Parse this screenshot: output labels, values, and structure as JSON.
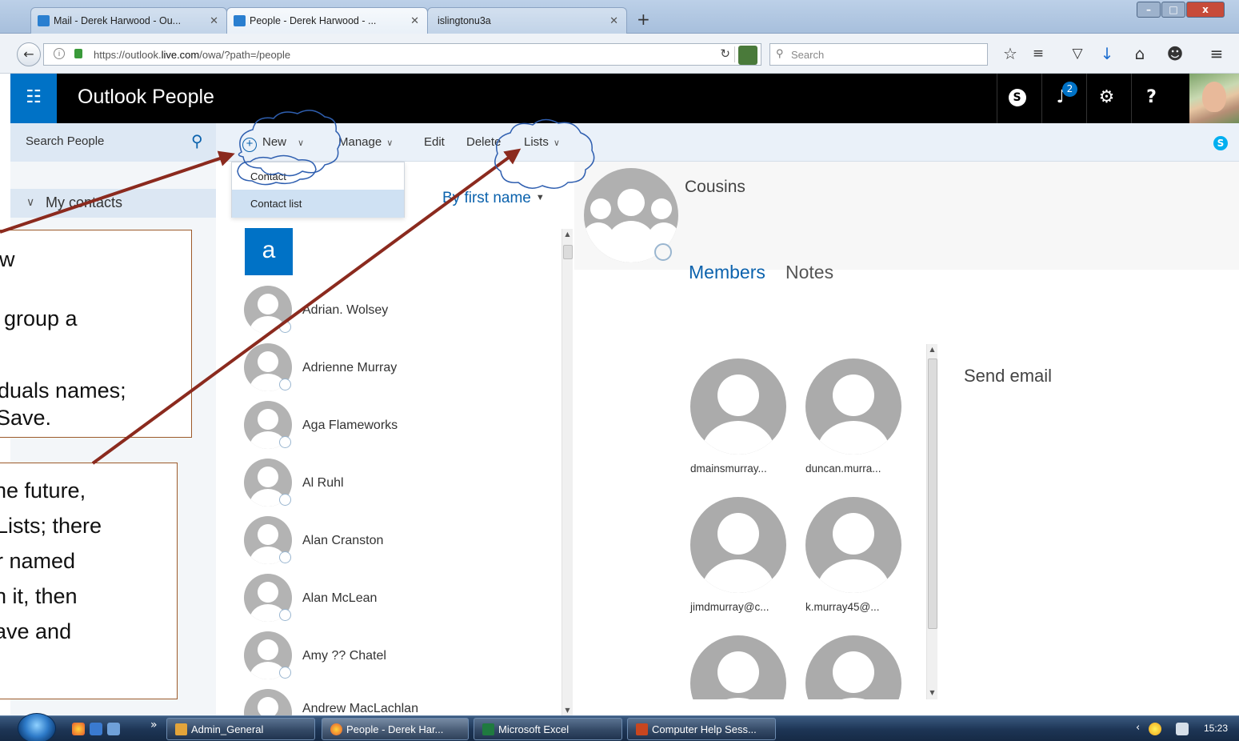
{
  "browser": {
    "tabs": [
      {
        "label": "Mail - Derek Harwood - Ou..."
      },
      {
        "label": "People - Derek Harwood - ..."
      },
      {
        "label": "islingtonu3a"
      }
    ],
    "new_tab": "+",
    "url_prefix": "https://outlook.",
    "url_host": "live.com",
    "url_suffix": "/owa/?path=/people",
    "search_placeholder": "Search",
    "window_controls": {
      "minimize": "–",
      "maximize": "□",
      "close": "x"
    }
  },
  "app": {
    "title": "Outlook People",
    "notifications_count": "2",
    "help_label": "?"
  },
  "commandbar": {
    "search_placeholder": "Search People",
    "new_label": "New",
    "manage_label": "Manage",
    "edit_label": "Edit",
    "delete_label": "Delete",
    "lists_label": "Lists"
  },
  "new_menu": {
    "items": [
      {
        "label": "Contact",
        "selected": false
      },
      {
        "label": "Contact list",
        "selected": true
      }
    ]
  },
  "sidebar": {
    "folder_label": "My contacts"
  },
  "contacts": {
    "sort_label": "By first name",
    "letter_header": "a",
    "items": [
      {
        "name": "Adrian. Wolsey"
      },
      {
        "name": "Adrienne Murray"
      },
      {
        "name": "Aga Flameworks"
      },
      {
        "name": "Al Ruhl"
      },
      {
        "name": "Alan Cranston"
      },
      {
        "name": "Alan McLean"
      },
      {
        "name": "Amy ?? Chatel"
      },
      {
        "name": "Andrew MacLachlan"
      }
    ]
  },
  "detail": {
    "group_name": "Cousins",
    "tabs": [
      {
        "label": "Members",
        "active": true
      },
      {
        "label": "Notes",
        "active": false
      }
    ],
    "members": [
      {
        "name": "dmainsmurray..."
      },
      {
        "name": "duncan.murra..."
      },
      {
        "name": "jimdmurray@c..."
      },
      {
        "name": "k.murray45@..."
      },
      {
        "name": ""
      },
      {
        "name": ""
      }
    ],
    "send_email_label": "Send email"
  },
  "annotations": {
    "callout_1_lines": [
      "w",
      "group a",
      "iduals names;",
      "Save."
    ],
    "callout_2_lines": [
      "he future,",
      "Lists; there",
      "r named",
      "n it, then",
      "ave and"
    ]
  },
  "taskbar": {
    "overflow": "»",
    "tasks": [
      {
        "label": "Admin_General",
        "active": false
      },
      {
        "label": "People - Derek Har...",
        "active": true
      },
      {
        "label": "Microsoft Excel",
        "active": false
      },
      {
        "label": "Computer Help Sess...",
        "active": false
      }
    ],
    "clock": "15:23"
  },
  "colors": {
    "accent": "#0072c6",
    "header_bg": "#000000",
    "annotation_arrow": "#8b2a1e",
    "callout_border": "#9c5a2a"
  }
}
